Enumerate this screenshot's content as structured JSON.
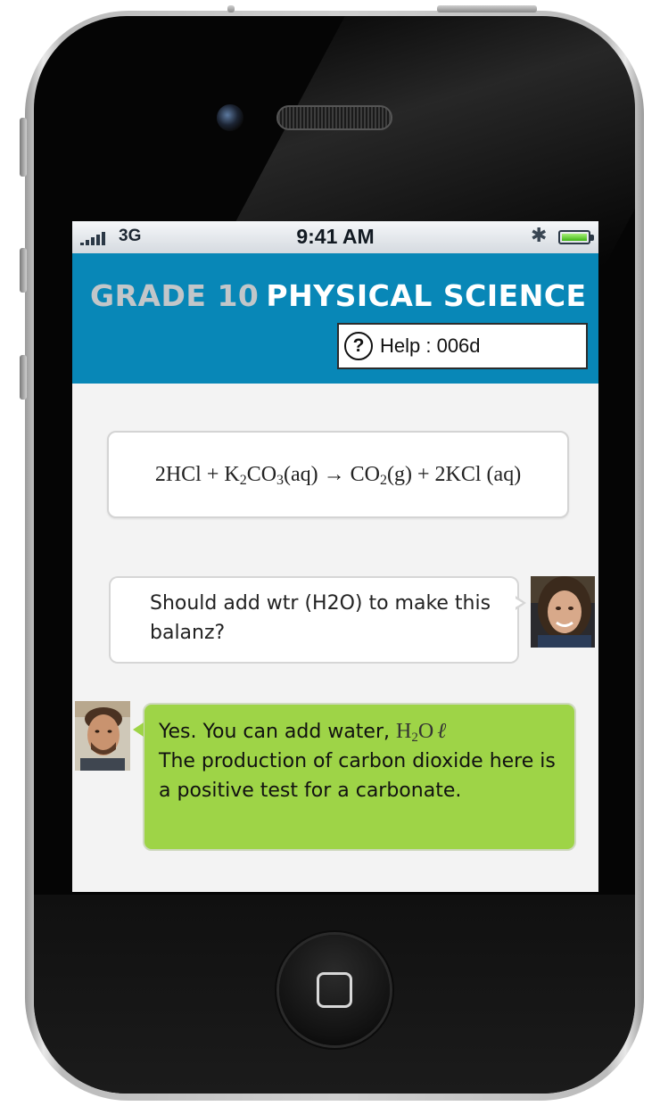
{
  "status_bar": {
    "carrier": "3G",
    "time": "9:41 AM",
    "icons": [
      "signal-bars-icon",
      "bluetooth-icon",
      "battery-icon"
    ]
  },
  "header": {
    "title_grade": "GRADE 10",
    "title_subject": "PHYSICAL SCIENCE",
    "help_icon": "?",
    "help_label": "Help : 006d",
    "background_color": "#0887b7"
  },
  "equation": {
    "lhs_1": "2HCl + K",
    "lhs_sub_1": "2",
    "lhs_2": "CO",
    "lhs_sub_2": "3",
    "lhs_3": "(aq) → CO",
    "rhs_sub_1": "2",
    "rhs_2": "(g) + 2KCl (aq)"
  },
  "chat": {
    "student_message": "Should add wtr (H2O) to make this balanz?",
    "tutor_message_line1": "Yes. You can add water,",
    "tutor_formula_h": "H",
    "tutor_formula_sub": "2",
    "tutor_formula_o": "O",
    "tutor_formula_state": "ℓ",
    "tutor_message_rest": "The production of carbon dioxide here is a positive test for a carbonate.",
    "tutor_bubble_color": "#9ed447"
  }
}
